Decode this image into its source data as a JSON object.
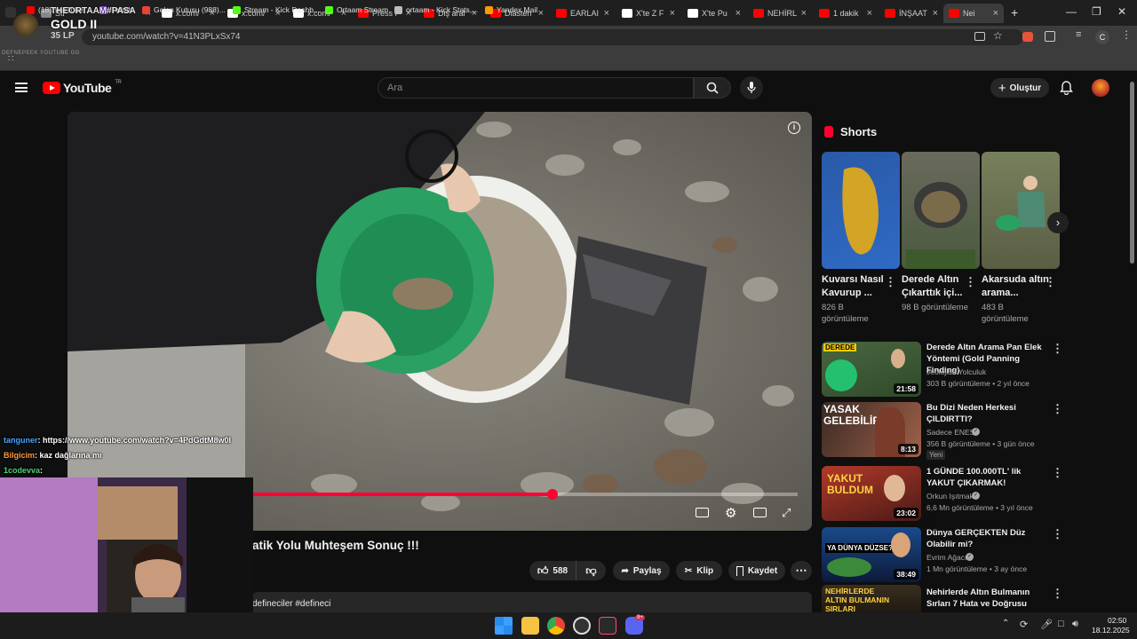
{
  "browser": {
    "tabs": [
      {
        "label": "Str",
        "color": "#888"
      },
      {
        "label": "x.com/",
        "color": "#ffffff"
      },
      {
        "label": "x.com/",
        "color": "#ffffff"
      },
      {
        "label": "x.com/",
        "color": "#ffffff"
      },
      {
        "label": "Press F",
        "color": "#ff0000"
      },
      {
        "label": "Diş aral",
        "color": "#ff0000"
      },
      {
        "label": "Diasten",
        "color": "#ff0000"
      },
      {
        "label": "EARLAI",
        "color": "#ff0000"
      },
      {
        "label": "X'te Z F",
        "color": "#ffffff"
      },
      {
        "label": "X'te Pu",
        "color": "#ffffff"
      },
      {
        "label": "NEHİRL",
        "color": "#ff0000"
      },
      {
        "label": "1 dakik",
        "color": "#ff0000"
      },
      {
        "label": "İNŞAAT",
        "color": "#ff0000"
      },
      {
        "label": "Nei",
        "color": "#ff0000"
      }
    ],
    "new_tab": "+",
    "url": "youtube.com/watch?v=41N3PLxSx74",
    "profile_initial": "C",
    "bookmarks": [
      {
        "label": "(18) YouTube",
        "color": "#ff0000"
      },
      {
        "label": "Twitch",
        "color": "#9146ff"
      },
      {
        "label": "Gelen Kutusu (988)...",
        "color": "#ea4335"
      },
      {
        "label": "Stream - Kick Dashb...",
        "color": "#53fc18"
      },
      {
        "label": "Ortaam Stream",
        "color": "#53fc18"
      },
      {
        "label": "ortaam - Kick Stats,...",
        "color": "#bbbbbb"
      },
      {
        "label": "Yandex Mail",
        "color": "#ff9900"
      }
    ]
  },
  "stream_overlay": {
    "channel": "THEORTAAM#PASA",
    "rank": "GOLD II",
    "lp": "35 LP",
    "tag": "DEFNEPEEK YOUTUBE GG",
    "chat": [
      {
        "user": "tanguner",
        "user_color": "#4aa3ff",
        "text": ": https://www.youtube.com/watch?v=4PdGdtM8w0I"
      },
      {
        "user": "Bilgicim",
        "user_color": "#ff9a3c",
        "text": ": kaz dağlarına mı"
      },
      {
        "user": "1codevva",
        "user_color": "#4ed17a",
        "text": ":"
      }
    ]
  },
  "youtube": {
    "logo_text": "YouTube",
    "logo_region": "TR",
    "search_placeholder": "Ara",
    "create_label": "Oluştur",
    "video": {
      "title": "atik Yolu Muhteşem Sonuç !!!",
      "progress_fraction": 0.55,
      "likes": "588",
      "share_label": "Paylaş",
      "clip_label": "Klip",
      "save_label": "Kaydet",
      "description_snippet": "defineciler #defineci"
    },
    "shorts_heading": "Shorts",
    "shorts": [
      {
        "title": "Kuvarsı Nasıl Kavurup ...",
        "views": "826 B görüntüleme"
      },
      {
        "title": "Derede Altın Çıkarttık içi...",
        "views": "98 B görüntüleme"
      },
      {
        "title": "Akarsuda altın arama...",
        "views": "483 B görüntüleme"
      }
    ],
    "recommendations": [
      {
        "title": "Derede Altın Arama Pan Elek Yöntemi (Gold Panning Finding)",
        "channel": "Jeolojide Yolculuk",
        "meta": "303 B görüntüleme • 2 yıl önce",
        "duration": "21:58",
        "badge": "",
        "thumb_text": "DEREDE"
      },
      {
        "title": "Bu Dizi Neden Herkesi ÇILDIRTTI?",
        "channel": "Sadece ENES",
        "meta": "356 B görüntüleme • 3 gün önce",
        "duration": "8:13",
        "badge": "Yeni",
        "thumb_text": "YASAK GELEBİLİR"
      },
      {
        "title": "1 GÜNDE 100.000TL' lik YAKUT ÇIKARMAK!",
        "channel": "Orkun Işıtmak",
        "meta": "6,6 Mn görüntüleme • 3 yıl önce",
        "duration": "23:02",
        "badge": "",
        "thumb_text": "YAKUT BULDUM"
      },
      {
        "title": "Dünya GERÇEKTEN Düz Olabilir mi?",
        "channel": "Evrim Ağacı",
        "meta": "1 Mn görüntüleme • 3 ay önce",
        "duration": "38:49",
        "badge": "",
        "thumb_text": "YA DÜNYA DÜZSE?"
      },
      {
        "title": "Nehirlerde Altın Bulmanın Sırları 7 Hata ve Doğrusu",
        "channel": "",
        "meta": "",
        "duration": "",
        "badge": "",
        "thumb_text": "NEHİRLERDE ALTIN BULMANIN SIRLARI"
      }
    ]
  },
  "taskbar": {
    "time": "02:50",
    "date": "18.12.2025",
    "discord_badge": "9+"
  }
}
